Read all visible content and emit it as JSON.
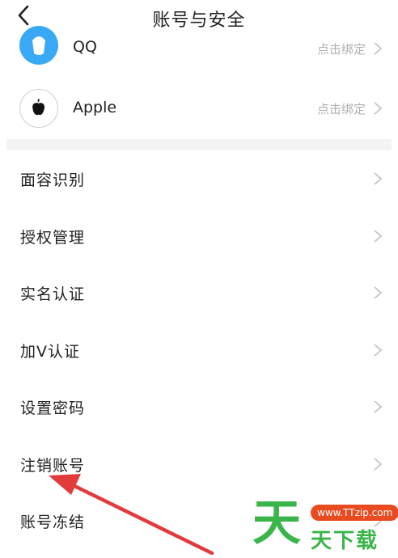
{
  "header": {
    "title": "账号与安全"
  },
  "bindings": [
    {
      "name": "QQ",
      "status": "点击绑定",
      "icon": "qq-icon"
    },
    {
      "name": "Apple",
      "status": "点击绑定",
      "icon": "apple-icon"
    }
  ],
  "menu": [
    {
      "label": "面容识别"
    },
    {
      "label": "授权管理"
    },
    {
      "label": "实名认证"
    },
    {
      "label": "加V认证"
    },
    {
      "label": "设置密码"
    },
    {
      "label": "注销账号"
    },
    {
      "label": "账号冻结"
    }
  ],
  "watermark": {
    "big": "天",
    "url": "www.TTzip.com",
    "text": "天下载"
  },
  "colors": {
    "accent_red": "#e23b3b",
    "qq_blue": "#3aa9f5",
    "watermark_green": "#3ab54a",
    "watermark_orange": "#e84b1f"
  }
}
